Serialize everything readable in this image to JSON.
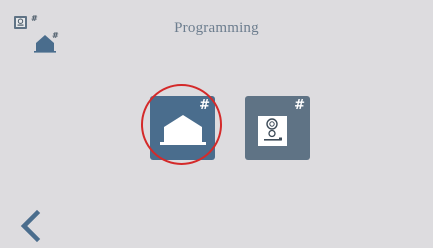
{
  "header": {
    "title": "Programming"
  },
  "status_icons": [
    {
      "name": "intercom-status-icon",
      "badge": "#"
    },
    {
      "name": "home-status-icon",
      "badge": "#"
    }
  ],
  "tiles": [
    {
      "name": "home-programming",
      "icon": "home-icon",
      "badge": "#",
      "highlighted": true
    },
    {
      "name": "intercom-programming",
      "icon": "intercom-icon",
      "badge": "#",
      "highlighted": false
    }
  ],
  "navigation": {
    "back_icon": "chevron-left-icon"
  },
  "colors": {
    "background": "#dddcdf",
    "tile_primary": "#4a6d8d",
    "tile_secondary": "#5f7385",
    "highlight": "#d42a2a",
    "title_text": "#6c7d8e"
  }
}
